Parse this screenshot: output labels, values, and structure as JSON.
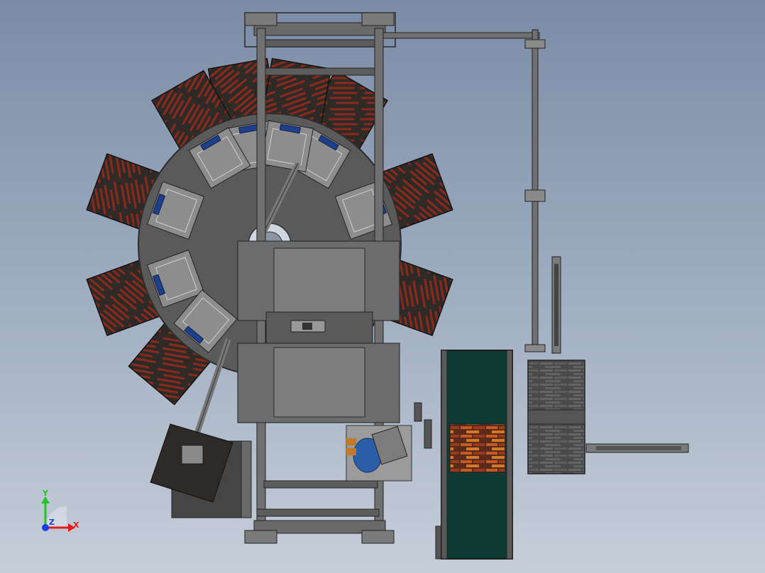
{
  "triad": {
    "x_label": "X",
    "y_label": "Y",
    "z_label": "Z"
  },
  "colors": {
    "background_top": "#7b8ca6",
    "background_bottom": "#c6ced9",
    "metal": "#555555",
    "frame": "#6a6a6a",
    "pallet": "#2f2a26",
    "brick": "#8a2a1e",
    "conveyor": "#0f3a34",
    "clamp": "#1f3f8a",
    "motor": "#2a5fa8",
    "axis_x": "#e41b1b",
    "axis_y": "#26c226",
    "axis_z": "#1b3fe4"
  }
}
